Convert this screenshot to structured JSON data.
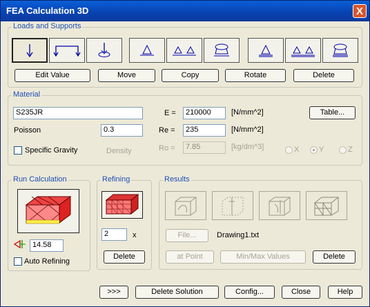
{
  "window": {
    "title": "FEA Calculation 3D",
    "close": "X"
  },
  "loads": {
    "group_label": "Loads and Supports",
    "edit_value": "Edit Value",
    "move": "Move",
    "copy": "Copy",
    "rotate": "Rotate",
    "delete": "Delete"
  },
  "material": {
    "group_label": "Material",
    "name": "S235JR",
    "e_label": "E =",
    "e_value": "210000",
    "e_unit": "[N/mm^2]",
    "table_button": "Table...",
    "poisson_label": "Poisson",
    "poisson_value": "0.3",
    "re_label": "Re =",
    "re_value": "235",
    "re_unit": "[N/mm^2]",
    "specific_gravity": "Specific Gravity",
    "density_label": "Density",
    "ro_label": "Ro =",
    "ro_value": "7.85",
    "ro_unit": "[kg/dm^3]",
    "axis_x": "X",
    "axis_y": "Y",
    "axis_z": "Z"
  },
  "run": {
    "group_label": "Run Calculation",
    "mesh_size": "14.58",
    "auto_refining": "Auto Refining"
  },
  "refining": {
    "group_label": "Refining",
    "factor": "2",
    "times": "x",
    "delete": "Delete"
  },
  "results": {
    "group_label": "Results",
    "file_button": "File...",
    "file_name": "Drawing1.txt",
    "at_point": "at Point",
    "min_max": "Min/Max Values",
    "delete": "Delete"
  },
  "footer": {
    "more": ">>>",
    "delete_solution": "Delete Solution",
    "config": "Config...",
    "close": "Close",
    "help": "Help"
  }
}
